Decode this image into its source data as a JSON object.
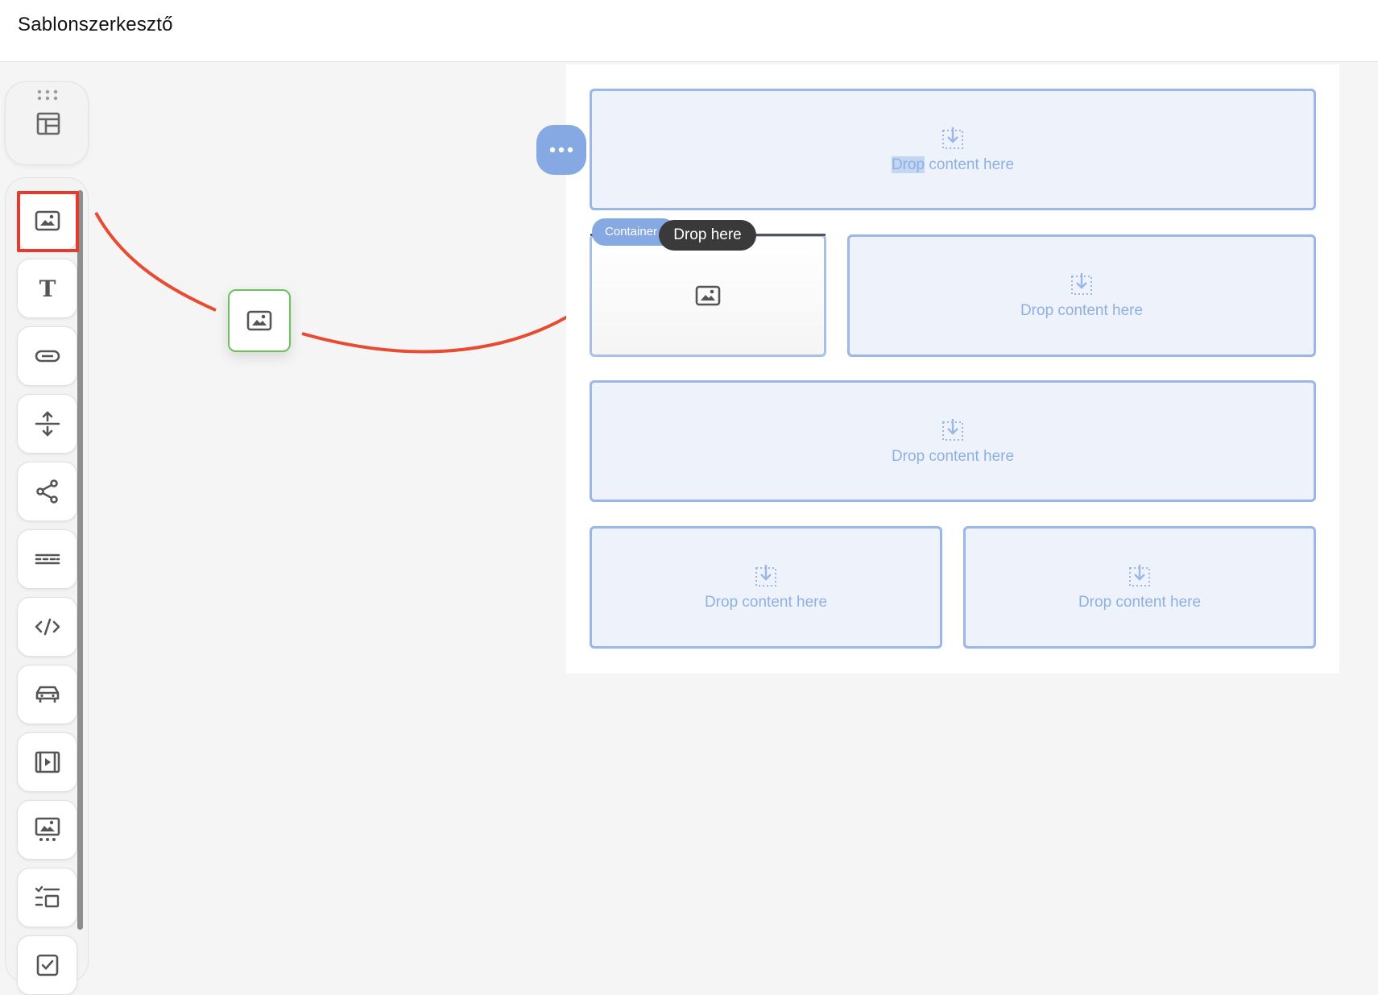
{
  "app": {
    "title": "Sablonszerkesztő"
  },
  "toolbar": {
    "layout_icon": "layout-icon",
    "tools": [
      {
        "name": "image-tool",
        "icon": "image-icon"
      },
      {
        "name": "text-tool",
        "icon": "text-icon"
      },
      {
        "name": "button-tool",
        "icon": "button-icon"
      },
      {
        "name": "spacer-tool",
        "icon": "spacer-icon"
      },
      {
        "name": "social-tool",
        "icon": "share-icon"
      },
      {
        "name": "divider-tool",
        "icon": "divider-icon"
      },
      {
        "name": "html-tool",
        "icon": "code-icon"
      },
      {
        "name": "product-tool",
        "icon": "car-icon"
      },
      {
        "name": "video-tool",
        "icon": "video-icon"
      },
      {
        "name": "gallery-tool",
        "icon": "gallery-icon"
      },
      {
        "name": "list-tool",
        "icon": "checklist-icon"
      },
      {
        "name": "checkbox-tool",
        "icon": "checkbox-icon"
      }
    ],
    "highlight_color": "#e53b2c"
  },
  "drag": {
    "ghost_icon": "image-icon",
    "ghost_border": "#6ac259",
    "arrow_color": "#e74c32"
  },
  "canvas": {
    "dropzone_label": "Drop content here",
    "dropzone_label_prefix": "Drop",
    "dropzone_label_suffix": " content here",
    "container_tag": "Container",
    "drop_tooltip": "Drop here",
    "accent": "#86a9e4"
  }
}
